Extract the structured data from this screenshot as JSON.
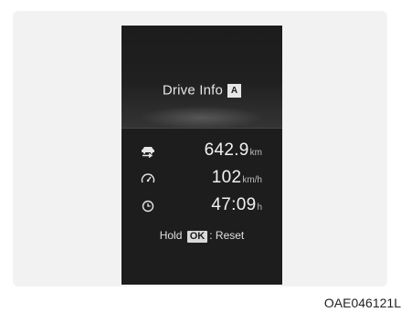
{
  "title": {
    "label": "Drive Info",
    "mode_badge": "A"
  },
  "rows": [
    {
      "icon": "distance-icon",
      "value": "642.9",
      "unit": "km"
    },
    {
      "icon": "speedometer-icon",
      "value": "102",
      "unit": "km/h"
    },
    {
      "icon": "clock-icon",
      "value": "47:09",
      "unit": "h"
    }
  ],
  "hint": {
    "prefix": "Hold",
    "key": "OK",
    "suffix": ": Reset"
  },
  "caption": "OAE046121L",
  "colors": {
    "screen_background": "#1e1d1d",
    "text": "#f2f2f2",
    "unit_text": "#bdbdbd"
  }
}
